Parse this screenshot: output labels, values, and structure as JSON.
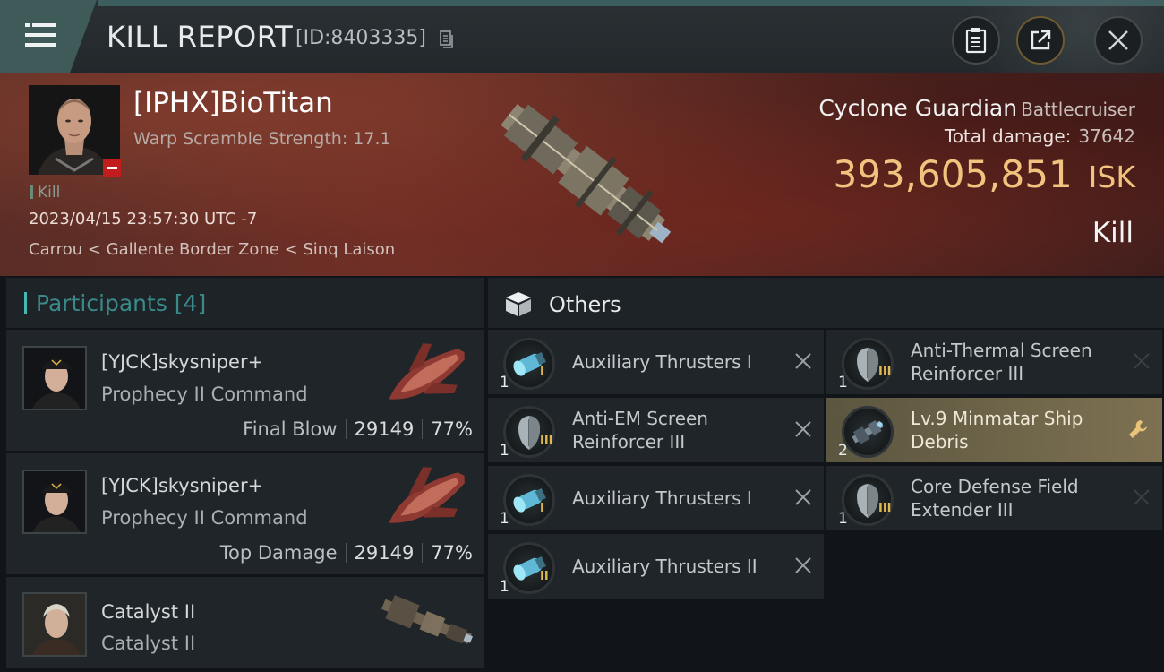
{
  "header": {
    "title": "KILL REPORT",
    "report_id": "[ID:8403335]",
    "icons": [
      "menu-icon",
      "copy-icon",
      "clipboard-icon",
      "share-icon",
      "close-icon"
    ]
  },
  "victim": {
    "name": "[IPHX]BioTitan",
    "warp_scramble": "Warp Scramble Strength: 17.1",
    "tag": "Kill",
    "datetime": "2023/04/15 23:57:30 UTC -7",
    "location": "Carrou < Gallente Border Zone < Sinq Laison",
    "ship_name": "Cyclone Guardian",
    "ship_class": "Battlecruiser",
    "total_damage_label": "Total damage:",
    "total_damage": "37642",
    "isk_value": "393,605,851",
    "isk_unit": "ISK",
    "result": "Kill"
  },
  "participants": {
    "label": "Participants [4]",
    "items": [
      {
        "name": "[YJCK]skysniper+",
        "ship": "Prophecy II Command",
        "role": "Final Blow",
        "damage": "29149",
        "percent": "77%"
      },
      {
        "name": "[YJCK]skysniper+",
        "ship": "Prophecy II Command",
        "role": "Top Damage",
        "damage": "29149",
        "percent": "77%"
      },
      {
        "name": "Catalyst II",
        "ship": "Catalyst II"
      }
    ]
  },
  "others": {
    "label": "Others",
    "col1": [
      {
        "qty": "1",
        "tier": "I",
        "name": "Auxiliary Thrusters I",
        "icon": "thruster-icon"
      },
      {
        "qty": "1",
        "tier": "III",
        "name": "Anti-EM Screen Reinforcer III",
        "icon": "shield-reinforcer-icon"
      },
      {
        "qty": "1",
        "tier": "I",
        "name": "Auxiliary Thrusters I",
        "icon": "thruster-icon"
      },
      {
        "qty": "1",
        "tier": "II",
        "name": "Auxiliary Thrusters II",
        "icon": "thruster-icon"
      }
    ],
    "col2": [
      {
        "qty": "1",
        "tier": "III",
        "name": "Anti-Thermal Screen Reinforcer III",
        "icon": "shield-reinforcer-icon"
      },
      {
        "qty": "2",
        "tier": "",
        "name": "Lv.9 Minmatar Ship Debris",
        "icon": "debris-icon"
      },
      {
        "qty": "1",
        "tier": "III",
        "name": "Core Defense Field Extender III",
        "icon": "shield-reinforcer-icon"
      }
    ]
  },
  "colors": {
    "accent_teal": "#45b8b2",
    "isk_gold": "#f2c37e",
    "tier_gold": "#e0b64f",
    "highlight_row": "#7e7152",
    "banner_red": "#6e3128"
  }
}
